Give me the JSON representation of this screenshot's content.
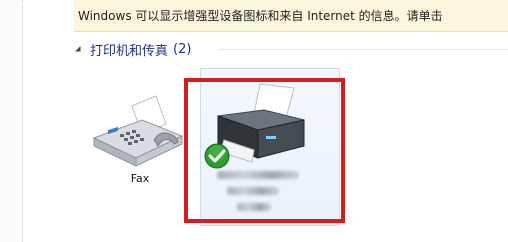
{
  "infobar": {
    "message": "Windows 可以显示增强型设备图标和来自 Internet 的信息。请单击"
  },
  "group": {
    "title": "打印机和传真",
    "count": "(2)"
  },
  "devices": [
    {
      "label": "Fax",
      "icon": "fax-icon"
    },
    {
      "label": "",
      "icon": "printer-icon",
      "status": "default-printer-check",
      "highlighted": true
    }
  ],
  "colors": {
    "infobar_bg": "#fbf7dc",
    "group_title": "#1e3287",
    "highlight": "#d21e1e",
    "check_green": "#2e9e2e"
  }
}
